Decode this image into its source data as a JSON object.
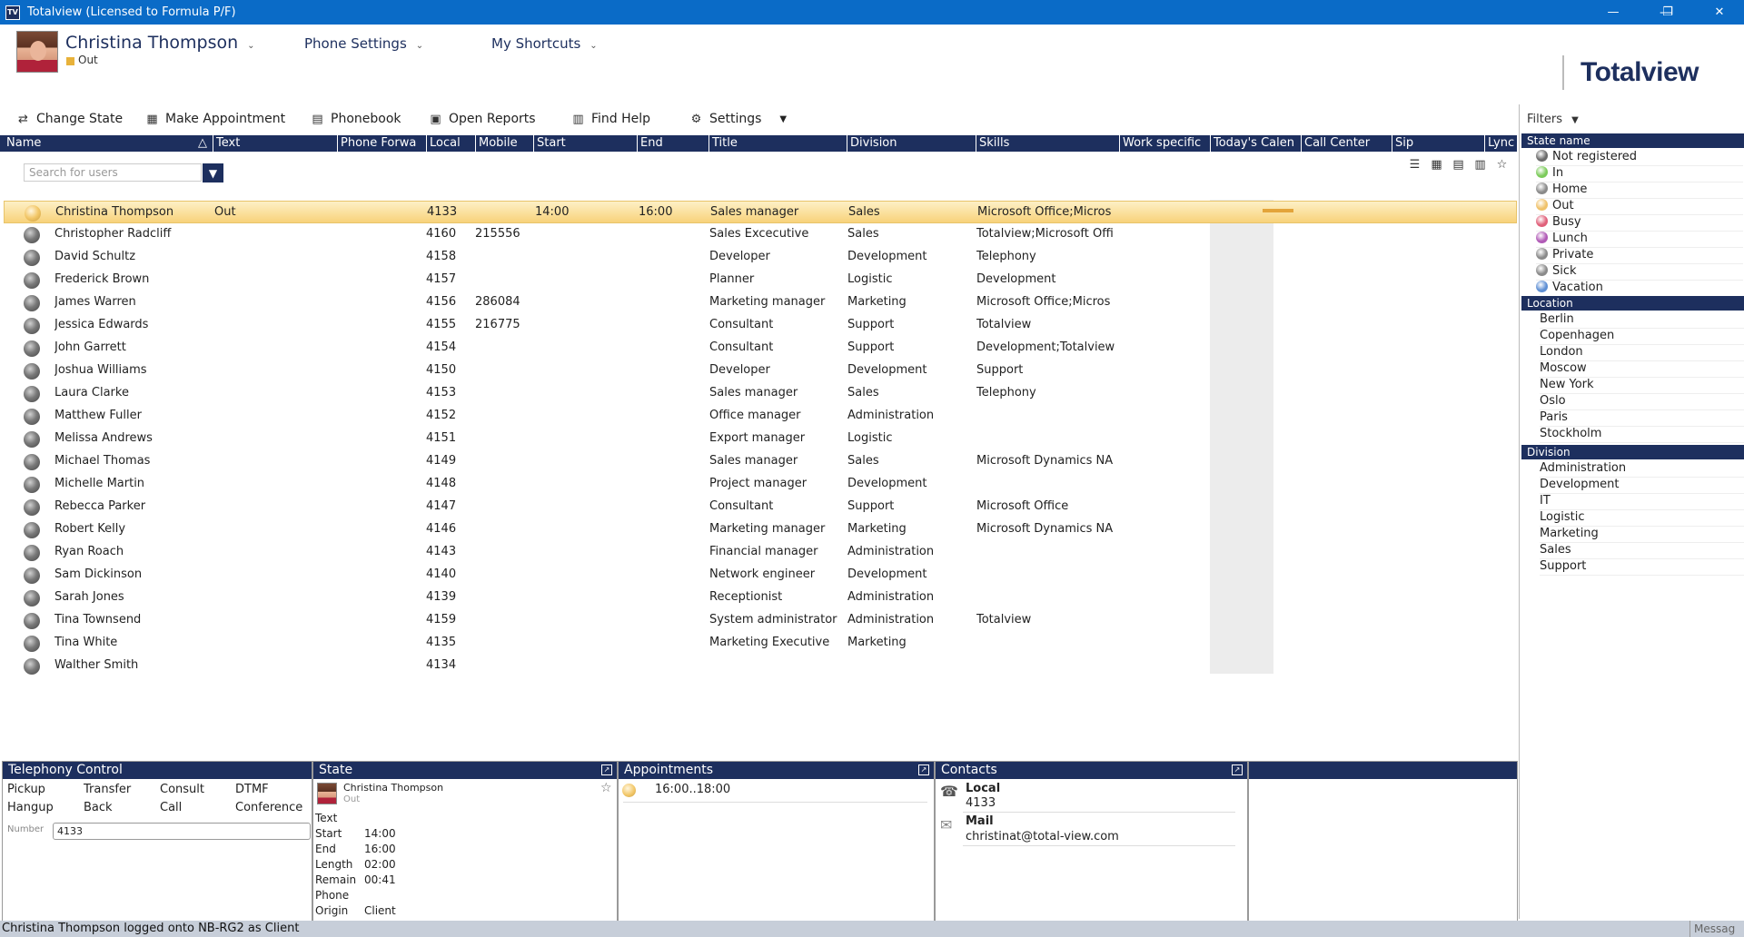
{
  "window": {
    "title": "Totalview  (Licensed to Formula P/F)",
    "app_icon": "TV",
    "minimize": "—",
    "restore": "❐",
    "close": "✕"
  },
  "header": {
    "user_name": "Christina Thompson",
    "user_state": "Out",
    "state_color": "#e8b23a",
    "menu_phone_settings": "Phone Settings",
    "menu_shortcuts": "My Shortcuts",
    "logo": "Totalview"
  },
  "toolbar": {
    "change_state": "Change State",
    "make_appointment": "Make Appointment",
    "phonebook": "Phonebook",
    "open_reports": "Open Reports",
    "find_help": "Find Help",
    "settings": "Settings"
  },
  "columns": [
    "Name",
    "Text",
    "Phone Forwa",
    "Local",
    "Mobile",
    "Start",
    "End",
    "Title",
    "Division",
    "Skills",
    "Work specific",
    "Today's Calen",
    "Call Center",
    "Sip",
    "Lync S"
  ],
  "search": {
    "placeholder": "Search for users"
  },
  "users": [
    {
      "name": "Christina Thompson",
      "text": "Out",
      "local": "4133",
      "mobile": "",
      "start": "14:00",
      "end": "16:00",
      "title": "Sales manager",
      "division": "Sales",
      "skills": "Microsoft Office;Micros"
    },
    {
      "name": "Christopher Radcliff",
      "text": "",
      "local": "4160",
      "mobile": "215556",
      "start": "",
      "end": "",
      "title": "Sales Excecutive",
      "division": "Sales",
      "skills": "Totalview;Microsoft Offi"
    },
    {
      "name": "David Schultz",
      "text": "",
      "local": "4158",
      "mobile": "",
      "start": "",
      "end": "",
      "title": "Developer",
      "division": "Development",
      "skills": "Telephony"
    },
    {
      "name": "Frederick Brown",
      "text": "",
      "local": "4157",
      "mobile": "",
      "start": "",
      "end": "",
      "title": "Planner",
      "division": "Logistic",
      "skills": "Development"
    },
    {
      "name": "James Warren",
      "text": "",
      "local": "4156",
      "mobile": "286084",
      "start": "",
      "end": "",
      "title": "Marketing manager",
      "division": "Marketing",
      "skills": "Microsoft Office;Micros"
    },
    {
      "name": "Jessica Edwards",
      "text": "",
      "local": "4155",
      "mobile": "216775",
      "start": "",
      "end": "",
      "title": "Consultant",
      "division": "Support",
      "skills": "Totalview"
    },
    {
      "name": "John Garrett",
      "text": "",
      "local": "4154",
      "mobile": "",
      "start": "",
      "end": "",
      "title": "Consultant",
      "division": "Support",
      "skills": "Development;Totalview"
    },
    {
      "name": "Joshua Williams",
      "text": "",
      "local": "4150",
      "mobile": "",
      "start": "",
      "end": "",
      "title": "Developer",
      "division": "Development",
      "skills": "Support"
    },
    {
      "name": "Laura Clarke",
      "text": "",
      "local": "4153",
      "mobile": "",
      "start": "",
      "end": "",
      "title": "Sales manager",
      "division": "Sales",
      "skills": "Telephony"
    },
    {
      "name": "Matthew Fuller",
      "text": "",
      "local": "4152",
      "mobile": "",
      "start": "",
      "end": "",
      "title": "Office manager",
      "division": "Administration",
      "skills": ""
    },
    {
      "name": "Melissa Andrews",
      "text": "",
      "local": "4151",
      "mobile": "",
      "start": "",
      "end": "",
      "title": "Export manager",
      "division": "Logistic",
      "skills": ""
    },
    {
      "name": "Michael Thomas",
      "text": "",
      "local": "4149",
      "mobile": "",
      "start": "",
      "end": "",
      "title": "Sales manager",
      "division": "Sales",
      "skills": "Microsoft Dynamics NA"
    },
    {
      "name": "Michelle Martin",
      "text": "",
      "local": "4148",
      "mobile": "",
      "start": "",
      "end": "",
      "title": "Project manager",
      "division": "Development",
      "skills": ""
    },
    {
      "name": "Rebecca Parker",
      "text": "",
      "local": "4147",
      "mobile": "",
      "start": "",
      "end": "",
      "title": "Consultant",
      "division": "Support",
      "skills": "Microsoft Office"
    },
    {
      "name": "Robert Kelly",
      "text": "",
      "local": "4146",
      "mobile": "",
      "start": "",
      "end": "",
      "title": "Marketing manager",
      "division": "Marketing",
      "skills": "Microsoft Dynamics NA"
    },
    {
      "name": "Ryan Roach",
      "text": "",
      "local": "4143",
      "mobile": "",
      "start": "",
      "end": "",
      "title": "Financial manager",
      "division": "Administration",
      "skills": ""
    },
    {
      "name": "Sam Dickinson",
      "text": "",
      "local": "4140",
      "mobile": "",
      "start": "",
      "end": "",
      "title": "Network engineer",
      "division": "Development",
      "skills": ""
    },
    {
      "name": "Sarah Jones",
      "text": "",
      "local": "4139",
      "mobile": "",
      "start": "",
      "end": "",
      "title": "Receptionist",
      "division": "Administration",
      "skills": ""
    },
    {
      "name": "Tina Townsend",
      "text": "",
      "local": "4159",
      "mobile": "",
      "start": "",
      "end": "",
      "title": "System administrator",
      "division": "Administration",
      "skills": "Totalview"
    },
    {
      "name": "Tina White",
      "text": "",
      "local": "4135",
      "mobile": "",
      "start": "",
      "end": "",
      "title": "Marketing Executive",
      "division": "Marketing",
      "skills": ""
    },
    {
      "name": "Walther Smith",
      "text": "",
      "local": "4134",
      "mobile": "",
      "start": "",
      "end": "",
      "title": "",
      "division": "",
      "skills": ""
    }
  ],
  "filters": {
    "title": "Filters",
    "state_header": "State name",
    "states": [
      {
        "label": "Not registered",
        "color": "#6b6b6b"
      },
      {
        "label": "In",
        "color": "#7ccb5b"
      },
      {
        "label": "Home",
        "color": "#8a8a8a"
      },
      {
        "label": "Out",
        "color": "#f0c26a"
      },
      {
        "label": "Busy",
        "color": "#e0607a"
      },
      {
        "label": "Lunch",
        "color": "#b05ab6"
      },
      {
        "label": "Private",
        "color": "#8a8a8a"
      },
      {
        "label": "Sick",
        "color": "#8a8a8a"
      },
      {
        "label": "Vacation",
        "color": "#5e8fd4"
      }
    ],
    "location_header": "Location",
    "locations": [
      "Berlin",
      "Copenhagen",
      "London",
      "Moscow",
      "New York",
      "Oslo",
      "Paris",
      "Stockholm"
    ],
    "division_header": "Division",
    "divisions": [
      "Administration",
      "Development",
      "IT",
      "Logistic",
      "Marketing",
      "Sales",
      "Support"
    ]
  },
  "telephony": {
    "title": "Telephony Control",
    "pickup": "Pickup",
    "transfer": "Transfer",
    "consult": "Consult",
    "dtmf": "DTMF",
    "hangup": "Hangup",
    "back": "Back",
    "call": "Call",
    "conference": "Conference",
    "number_label": "Number",
    "number_value": "4133"
  },
  "state_panel": {
    "title": "State",
    "name": "Christina Thompson",
    "state": "Out",
    "text_label": "Text",
    "start_label": "Start",
    "start_value": "14:00",
    "end_label": "End",
    "end_value": "16:00",
    "length_label": "Length",
    "length_value": "02:00",
    "remain_label": "Remain",
    "remain_value": "00:41",
    "phone_label": "Phone",
    "origin_label": "Origin",
    "origin_value": "Client"
  },
  "appointments": {
    "title": "Appointments",
    "item": "16:00..18:00"
  },
  "contacts": {
    "title": "Contacts",
    "local_label": "Local",
    "local_value": "4133",
    "mail_label": "Mail",
    "mail_value": "christinat@total-view.com"
  },
  "statusbar": {
    "message": "Christina Thompson logged onto NB-RG2 as Client",
    "right": "Messag"
  }
}
